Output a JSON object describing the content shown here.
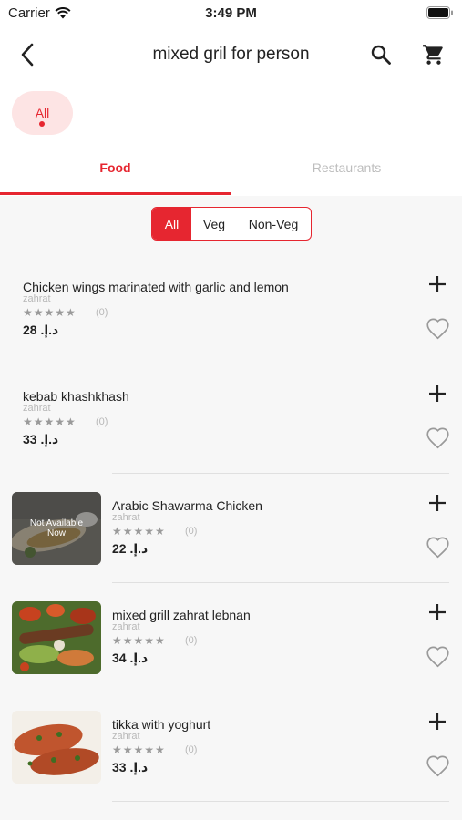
{
  "status_bar": {
    "carrier": "Carrier",
    "time": "3:49 PM"
  },
  "header": {
    "title": "mixed gril for person"
  },
  "filter_chip": {
    "label": "All"
  },
  "tabs": [
    {
      "label": "Food"
    },
    {
      "label": "Restaurants"
    }
  ],
  "diet_filter": [
    {
      "label": "All"
    },
    {
      "label": "Veg"
    },
    {
      "label": "Non-Veg"
    }
  ],
  "stars_glyph": "★★★★★",
  "items": [
    {
      "name": "Chicken wings marinated with garlic and lemon",
      "restaurant": "zahrat",
      "rating_count": "(0)",
      "price": "28 .د.إ",
      "rating": 0,
      "has_image": false
    },
    {
      "name": "kebab khashkhash",
      "restaurant": "zahrat",
      "rating_count": "(0)",
      "price": "33 .د.إ",
      "rating": 0,
      "has_image": false
    },
    {
      "name": "Arabic Shawarma Chicken",
      "restaurant": "zahrat",
      "rating_count": "(0)",
      "price": "22 .د.إ",
      "rating": 0,
      "has_image": true,
      "availability": "Not Available Now"
    },
    {
      "name": "mixed grill zahrat lebnan",
      "restaurant": "zahrat",
      "rating_count": "(0)",
      "price": "34 .د.إ",
      "rating": 0,
      "has_image": true
    },
    {
      "name": "tikka with yoghurt",
      "restaurant": "zahrat",
      "rating_count": "(0)",
      "price": "33 .د.إ",
      "rating": 0,
      "has_image": true
    }
  ],
  "colors": {
    "accent": "#e62630",
    "chip_bg": "#fde4e4",
    "page_bg": "#f7f7f7"
  },
  "icons": {
    "back": "chevron-left-icon",
    "search": "search-icon",
    "cart": "cart-icon",
    "add": "plus-icon",
    "favorite": "heart-outline-icon"
  }
}
